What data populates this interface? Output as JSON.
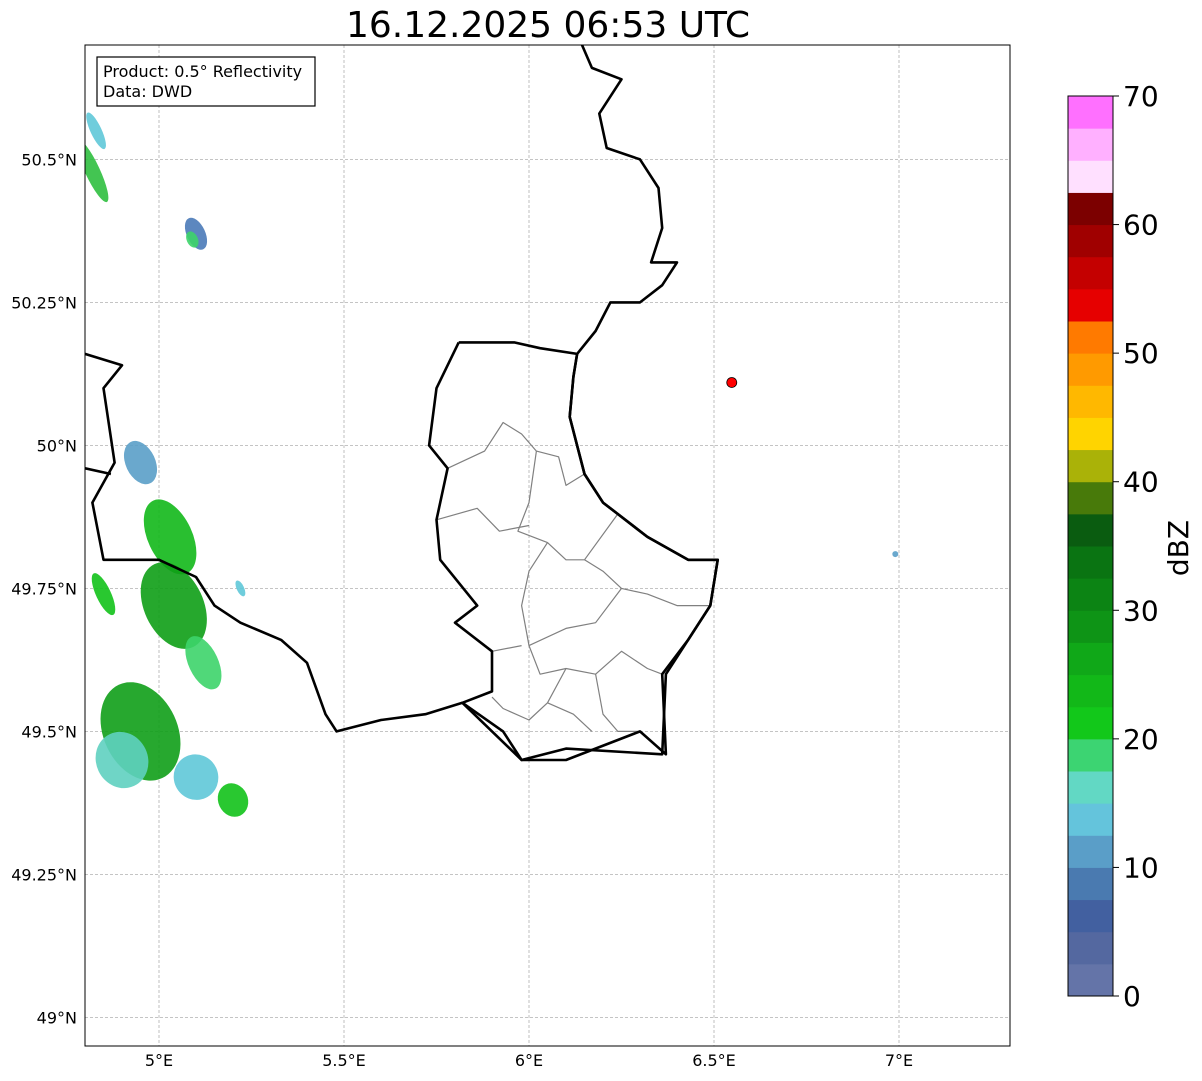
{
  "title": "16.12.2025 06:53 UTC",
  "info": {
    "product": "Product: 0.5° Reflectivity",
    "data_source": "Data: DWD"
  },
  "map": {
    "lon_range": [
      4.8,
      7.3
    ],
    "lat_range": [
      48.95,
      50.7
    ],
    "lon_ticks": [
      {
        "value": 5.0,
        "label": "5°E"
      },
      {
        "value": 5.5,
        "label": "5.5°E"
      },
      {
        "value": 6.0,
        "label": "6°E"
      },
      {
        "value": 6.5,
        "label": "6.5°E"
      },
      {
        "value": 7.0,
        "label": "7°E"
      }
    ],
    "lat_ticks": [
      {
        "value": 49.0,
        "label": "49°N"
      },
      {
        "value": 49.25,
        "label": "49.25°N"
      },
      {
        "value": 49.5,
        "label": "49.5°N"
      },
      {
        "value": 49.75,
        "label": "49.75°N"
      },
      {
        "value": 50.0,
        "label": "50°N"
      },
      {
        "value": 50.25,
        "label": "50.25°N"
      },
      {
        "value": 50.5,
        "label": "50.5°N"
      }
    ],
    "grid": true,
    "radar_site": {
      "lon": 6.548,
      "lat": 50.11,
      "color": "#ff0000"
    },
    "country_border_color": "#000000",
    "region_border_color": "#808080",
    "country_border": [
      [
        6.13,
        50.72
      ],
      [
        6.17,
        50.66
      ],
      [
        6.25,
        50.64
      ],
      [
        6.19,
        50.58
      ],
      [
        6.21,
        50.52
      ],
      [
        6.3,
        50.5
      ],
      [
        6.35,
        50.45
      ],
      [
        6.36,
        50.38
      ],
      [
        6.33,
        50.32
      ],
      [
        6.4,
        50.32
      ],
      [
        6.36,
        50.28
      ],
      [
        6.3,
        50.25
      ],
      [
        6.22,
        50.25
      ],
      [
        6.18,
        50.2
      ],
      [
        6.13,
        50.16
      ],
      [
        6.12,
        50.12
      ],
      [
        6.11,
        50.05
      ],
      [
        6.13,
        50.0
      ],
      [
        6.15,
        49.95
      ],
      [
        6.2,
        49.9
      ],
      [
        6.24,
        49.88
      ],
      [
        6.32,
        49.84
      ],
      [
        6.43,
        49.8
      ],
      [
        6.51,
        49.8
      ],
      [
        6.49,
        49.72
      ],
      [
        6.43,
        49.66
      ],
      [
        6.36,
        49.6
      ],
      [
        6.37,
        49.46
      ],
      [
        6.3,
        49.5
      ],
      [
        6.1,
        49.45
      ],
      [
        6.03,
        49.45
      ],
      [
        5.98,
        49.45
      ],
      [
        5.93,
        49.5
      ],
      [
        5.82,
        49.55
      ],
      [
        5.72,
        49.53
      ],
      [
        5.6,
        49.52
      ],
      [
        5.48,
        49.5
      ],
      [
        5.45,
        49.53
      ],
      [
        5.4,
        49.62
      ],
      [
        5.33,
        49.66
      ],
      [
        5.22,
        49.69
      ],
      [
        5.15,
        49.72
      ],
      [
        5.1,
        49.77
      ],
      [
        5.0,
        49.8
      ],
      [
        4.85,
        49.8
      ],
      [
        4.82,
        49.9
      ],
      [
        4.88,
        49.97
      ],
      [
        4.85,
        50.1
      ],
      [
        4.9,
        50.14
      ],
      [
        4.8,
        50.16
      ]
    ],
    "country_border_2": [
      [
        4.8,
        49.96
      ],
      [
        4.87,
        49.95
      ]
    ],
    "luxembourg_border": [
      [
        5.81,
        50.18
      ],
      [
        5.75,
        50.1
      ],
      [
        5.73,
        50.0
      ],
      [
        5.78,
        49.96
      ],
      [
        5.75,
        49.87
      ],
      [
        5.76,
        49.8
      ],
      [
        5.86,
        49.72
      ],
      [
        5.8,
        49.69
      ],
      [
        5.9,
        49.64
      ],
      [
        5.9,
        49.57
      ],
      [
        5.82,
        49.55
      ],
      [
        5.98,
        49.45
      ],
      [
        6.1,
        49.47
      ],
      [
        6.36,
        49.46
      ],
      [
        6.37,
        49.6
      ],
      [
        6.43,
        49.66
      ],
      [
        6.49,
        49.72
      ],
      [
        6.51,
        49.8
      ],
      [
        6.43,
        49.8
      ],
      [
        6.32,
        49.84
      ],
      [
        6.24,
        49.88
      ],
      [
        6.2,
        49.9
      ],
      [
        6.15,
        49.95
      ],
      [
        6.13,
        50.0
      ],
      [
        6.11,
        50.05
      ],
      [
        6.12,
        50.12
      ],
      [
        6.13,
        50.16
      ],
      [
        6.03,
        50.17
      ],
      [
        5.96,
        50.18
      ],
      [
        5.91,
        50.18
      ],
      [
        5.81,
        50.18
      ]
    ],
    "region_lines": [
      [
        [
          5.78,
          49.96
        ],
        [
          5.88,
          49.99
        ],
        [
          5.93,
          50.04
        ],
        [
          5.98,
          50.02
        ],
        [
          6.02,
          49.99
        ],
        [
          6.08,
          49.98
        ],
        [
          6.1,
          49.93
        ],
        [
          6.15,
          49.95
        ]
      ],
      [
        [
          6.02,
          49.99
        ],
        [
          6.0,
          49.9
        ],
        [
          5.97,
          49.85
        ],
        [
          6.05,
          49.83
        ],
        [
          6.1,
          49.8
        ],
        [
          6.15,
          49.8
        ],
        [
          6.24,
          49.88
        ]
      ],
      [
        [
          5.75,
          49.87
        ],
        [
          5.86,
          49.89
        ],
        [
          5.92,
          49.85
        ],
        [
          6.0,
          49.86
        ]
      ],
      [
        [
          6.05,
          49.83
        ],
        [
          6.0,
          49.78
        ],
        [
          5.98,
          49.72
        ],
        [
          6.0,
          49.65
        ],
        [
          6.03,
          49.6
        ],
        [
          6.1,
          49.61
        ],
        [
          6.18,
          49.6
        ],
        [
          6.25,
          49.64
        ],
        [
          6.32,
          49.61
        ],
        [
          6.36,
          49.6
        ]
      ],
      [
        [
          6.15,
          49.8
        ],
        [
          6.2,
          49.78
        ],
        [
          6.25,
          49.75
        ],
        [
          6.32,
          49.74
        ],
        [
          6.4,
          49.72
        ],
        [
          6.49,
          49.72
        ]
      ],
      [
        [
          6.25,
          49.75
        ],
        [
          6.18,
          49.69
        ],
        [
          6.1,
          49.68
        ],
        [
          6.0,
          49.65
        ]
      ],
      [
        [
          5.9,
          49.64
        ],
        [
          5.98,
          49.65
        ]
      ],
      [
        [
          6.1,
          49.61
        ],
        [
          6.05,
          49.55
        ],
        [
          6.0,
          49.52
        ],
        [
          5.93,
          49.54
        ],
        [
          5.9,
          49.56
        ]
      ],
      [
        [
          6.18,
          49.6
        ],
        [
          6.2,
          49.53
        ],
        [
          6.24,
          49.5
        ],
        [
          6.3,
          49.5
        ]
      ],
      [
        [
          6.05,
          49.55
        ],
        [
          6.12,
          49.53
        ],
        [
          6.17,
          49.5
        ]
      ]
    ],
    "echoes": [
      {
        "lon": 4.82,
        "lat": 50.48,
        "w": 0.04,
        "h": 0.12,
        "color": "#2fbf3f"
      },
      {
        "lon": 4.83,
        "lat": 50.55,
        "w": 0.03,
        "h": 0.07,
        "color": "#5fc8d8"
      },
      {
        "lon": 5.1,
        "lat": 50.37,
        "w": 0.05,
        "h": 0.06,
        "color": "#4a7ab8"
      },
      {
        "lon": 5.09,
        "lat": 50.36,
        "w": 0.03,
        "h": 0.03,
        "color": "#3dd46a"
      },
      {
        "lon": 4.95,
        "lat": 49.97,
        "w": 0.08,
        "h": 0.08,
        "color": "#5a9ec8"
      },
      {
        "lon": 5.03,
        "lat": 49.84,
        "w": 0.12,
        "h": 0.14,
        "color": "#12b81a"
      },
      {
        "lon": 5.04,
        "lat": 49.72,
        "w": 0.16,
        "h": 0.16,
        "color": "#0e9e16"
      },
      {
        "lon": 5.12,
        "lat": 49.62,
        "w": 0.08,
        "h": 0.1,
        "color": "#3dd46a"
      },
      {
        "lon": 4.85,
        "lat": 49.74,
        "w": 0.04,
        "h": 0.08,
        "color": "#12c21a"
      },
      {
        "lon": 4.95,
        "lat": 49.5,
        "w": 0.2,
        "h": 0.18,
        "color": "#109e18"
      },
      {
        "lon": 4.9,
        "lat": 49.45,
        "w": 0.14,
        "h": 0.1,
        "color": "#5fd0c0"
      },
      {
        "lon": 5.1,
        "lat": 49.42,
        "w": 0.12,
        "h": 0.08,
        "color": "#5fc8d8"
      },
      {
        "lon": 5.2,
        "lat": 49.38,
        "w": 0.08,
        "h": 0.06,
        "color": "#12c21a"
      },
      {
        "lon": 5.22,
        "lat": 49.75,
        "w": 0.02,
        "h": 0.03,
        "color": "#5fc8d8"
      },
      {
        "lon": 6.99,
        "lat": 49.81,
        "w": 0.01,
        "h": 0.01,
        "color": "#5a9ec8"
      }
    ]
  },
  "colorbar": {
    "label": "dBZ",
    "min": 0,
    "max": 70,
    "step": 2.5,
    "tick_labels": [
      {
        "value": 0,
        "label": "0"
      },
      {
        "value": 10,
        "label": "10"
      },
      {
        "value": 20,
        "label": "20"
      },
      {
        "value": 30,
        "label": "30"
      },
      {
        "value": 40,
        "label": "40"
      },
      {
        "value": 50,
        "label": "50"
      },
      {
        "value": 60,
        "label": "60"
      },
      {
        "value": 70,
        "label": "70"
      }
    ],
    "colors": [
      "#6474a8",
      "#5468a0",
      "#4260a0",
      "#4a7ab0",
      "#5a9ec8",
      "#64c4dc",
      "#62d8c4",
      "#3cd472",
      "#12c81a",
      "#12b818",
      "#10a818",
      "#0e9416",
      "#0c8414",
      "#0a7412",
      "#0a5c10",
      "#487a0a",
      "#aab208",
      "#ffd400",
      "#ffb800",
      "#ff9a00",
      "#ff7a00",
      "#e60000",
      "#c40000",
      "#a00000",
      "#7c0000",
      "#ffe0ff",
      "#ffb0ff",
      "#ff70ff",
      "#ee38ee"
    ]
  }
}
